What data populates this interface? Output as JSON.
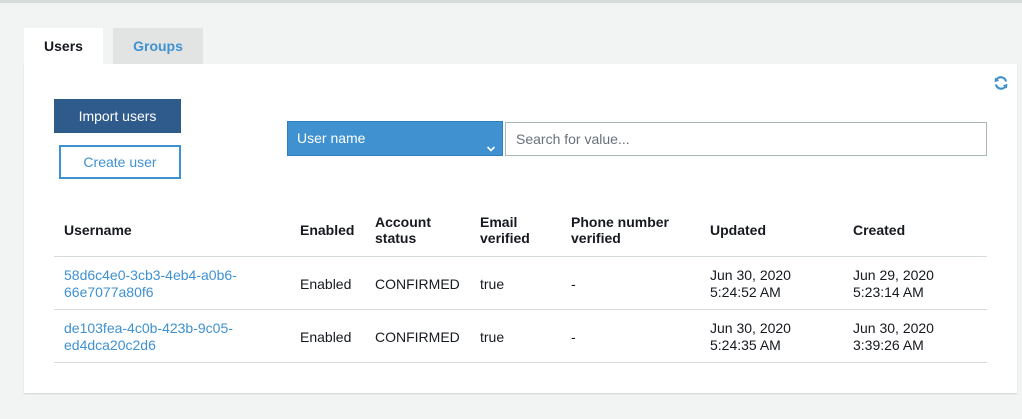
{
  "tabs": {
    "users": "Users",
    "groups": "Groups"
  },
  "icons": {
    "refresh": "refresh-icon",
    "chevron": "chevron-down-icon"
  },
  "colors": {
    "primary": "#2e5b8c",
    "accent": "#3f91d0",
    "border": "#d5dbdb"
  },
  "actions": {
    "import_users": "Import users",
    "create_user": "Create user"
  },
  "filter": {
    "attribute": "User name",
    "search_placeholder": "Search for value..."
  },
  "table": {
    "headers": {
      "username": "Username",
      "enabled": "Enabled",
      "account_status_1": "Account",
      "account_status_2": "status",
      "email_verified_1": "Email",
      "email_verified_2": "verified",
      "phone_verified_1": "Phone number",
      "phone_verified_2": "verified",
      "updated": "Updated",
      "created": "Created"
    },
    "rows": [
      {
        "username_1": "58d6c4e0-3cb3-4eb4-a0b6-",
        "username_2": "66e7077a80f6",
        "enabled": "Enabled",
        "account_status": "CONFIRMED",
        "email_verified": "true",
        "phone_verified": "-",
        "updated_1": "Jun 30, 2020",
        "updated_2": "5:24:52 AM",
        "created_1": "Jun 29, 2020",
        "created_2": "5:23:14 AM"
      },
      {
        "username_1": "de103fea-4c0b-423b-9c05-",
        "username_2": "ed4dca20c2d6",
        "enabled": "Enabled",
        "account_status": "CONFIRMED",
        "email_verified": "true",
        "phone_verified": "-",
        "updated_1": "Jun 30, 2020",
        "updated_2": "5:24:35 AM",
        "created_1": "Jun 30, 2020",
        "created_2": "3:39:26 AM"
      }
    ]
  }
}
